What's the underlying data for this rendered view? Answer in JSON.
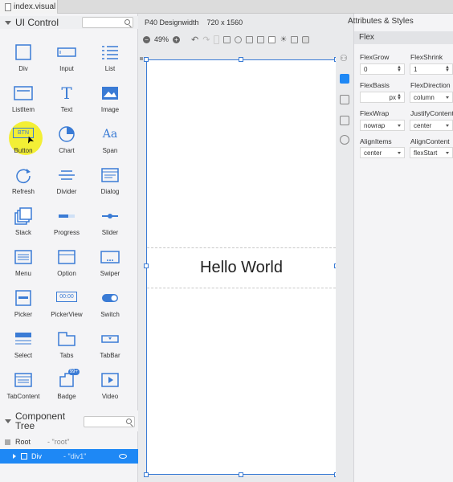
{
  "tab": {
    "title": "index.visual"
  },
  "left": {
    "ui_control_title": "UI Control",
    "components": [
      {
        "name": "Div",
        "icon": "div-icon"
      },
      {
        "name": "Input",
        "icon": "input-icon"
      },
      {
        "name": "List",
        "icon": "list-icon"
      },
      {
        "name": "ListItem",
        "icon": "listitem-icon"
      },
      {
        "name": "Text",
        "icon": "text-icon"
      },
      {
        "name": "Image",
        "icon": "image-icon"
      },
      {
        "name": "Button",
        "icon": "button-icon"
      },
      {
        "name": "Chart",
        "icon": "chart-icon"
      },
      {
        "name": "Span",
        "icon": "span-icon"
      },
      {
        "name": "Refresh",
        "icon": "refresh-icon"
      },
      {
        "name": "Divider",
        "icon": "divider-icon"
      },
      {
        "name": "Dialog",
        "icon": "dialog-icon"
      },
      {
        "name": "Stack",
        "icon": "stack-icon"
      },
      {
        "name": "Progress",
        "icon": "progress-icon"
      },
      {
        "name": "Slider",
        "icon": "slider-icon"
      },
      {
        "name": "Menu",
        "icon": "menu-icon"
      },
      {
        "name": "Option",
        "icon": "option-icon"
      },
      {
        "name": "Swiper",
        "icon": "swiper-icon"
      },
      {
        "name": "Picker",
        "icon": "picker-icon"
      },
      {
        "name": "PickerView",
        "icon": "pickerview-icon"
      },
      {
        "name": "Switch",
        "icon": "switch-icon"
      },
      {
        "name": "Select",
        "icon": "select-icon"
      },
      {
        "name": "Tabs",
        "icon": "tabs-icon"
      },
      {
        "name": "TabBar",
        "icon": "tabbar-icon"
      },
      {
        "name": "TabContent",
        "icon": "tabcontent-icon"
      },
      {
        "name": "Badge",
        "icon": "badge-icon"
      },
      {
        "name": "Video",
        "icon": "video-icon"
      }
    ],
    "button_icon_text": "BTN",
    "text_icon_glyph": "T",
    "span_icon_glyph": "Aa",
    "badge_icon_text": "99+",
    "picker_view_icon_text": "00:00",
    "component_tree_title": "Component Tree",
    "tree": [
      {
        "label": "Root",
        "id": "- \"root\""
      },
      {
        "label": "Div",
        "id": "- \"div1\""
      }
    ]
  },
  "canvas": {
    "device": "P40 Designwidth",
    "resolution": "720 x 1560",
    "zoom": "49%",
    "zoom_out": "−",
    "zoom_in": "+",
    "hello_text": "Hello World"
  },
  "attributes": {
    "title": "Attributes & Styles",
    "section": "Flex",
    "fields": {
      "flex_grow_label": "FlexGrow",
      "flex_grow_value": "0",
      "flex_shrink_label": "FlexShrink",
      "flex_shrink_value": "1",
      "flex_basis_label": "FlexBasis",
      "flex_basis_unit": "px",
      "flex_direction_label": "FlexDirection",
      "flex_direction_value": "column",
      "flex_wrap_label": "FlexWrap",
      "flex_wrap_value": "nowrap",
      "justify_label": "JustifyContent",
      "justify_value": "center",
      "align_items_label": "AlignItems",
      "align_items_value": "center",
      "align_content_label": "AlignContent",
      "align_content_value": "flexStart"
    }
  },
  "colors": {
    "accent": "#3a7bd5",
    "selection": "#1e88f5",
    "highlight": "#f2ee2a"
  }
}
